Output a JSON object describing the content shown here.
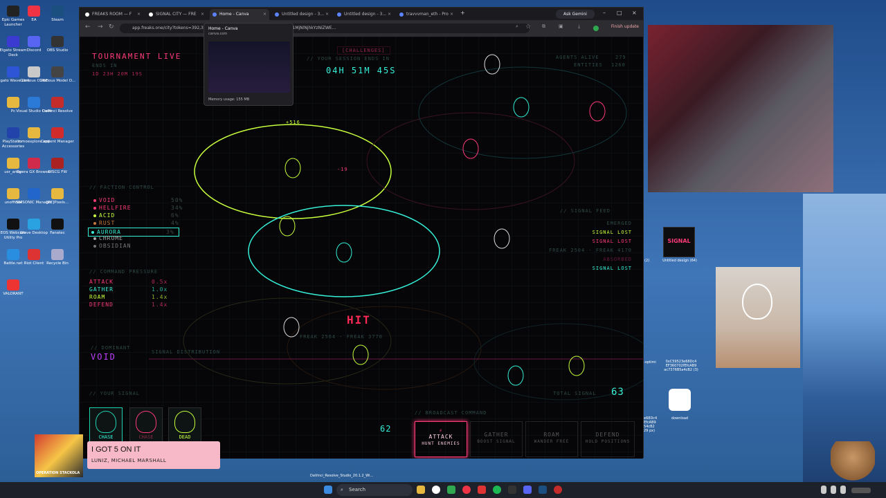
{
  "desktop_icons": [
    {
      "label": "Epic Games Launcher",
      "color": "#222"
    },
    {
      "label": "EA",
      "color": "#e34"
    },
    {
      "label": "Steam",
      "color": "#1b4f7f"
    },
    {
      "label": "Elgato Stream Deck",
      "color": "#3b3bd1"
    },
    {
      "label": "Discord",
      "color": "#5865f2"
    },
    {
      "label": "OBS Studio",
      "color": "#333"
    },
    {
      "label": "Elgato Wave Link",
      "color": "#2e55d6"
    },
    {
      "label": "Glorious CORE",
      "color": "#c9c9c9"
    },
    {
      "label": "Glorious Model O...",
      "color": "#444"
    },
    {
      "label": "Pc",
      "color": "#e7b83f"
    },
    {
      "label": "Visual Studio Code",
      "color": "#2b7ad8"
    },
    {
      "label": "DaVinci Resolve",
      "color": "#c42b2b"
    },
    {
      "label": "PlayStation Accessories",
      "color": "#2244aa"
    },
    {
      "label": "mmoexplore app",
      "color": "#e7b83f"
    },
    {
      "label": "Content Manager",
      "color": "#d12b2b"
    },
    {
      "label": "usr_army",
      "color": "#e7b83f"
    },
    {
      "label": "Opera GX Browser",
      "color": "#d12b4b"
    },
    {
      "label": "DISCG FW",
      "color": "#aa2222"
    },
    {
      "label": "unofficial",
      "color": "#e7b83f"
    },
    {
      "label": "SIMSONIC Manager",
      "color": "#2266cc"
    },
    {
      "label": "[PC]Pixels...",
      "color": "#e7b83f"
    },
    {
      "label": "EOS Webcam Utility Pro",
      "color": "#111"
    },
    {
      "label": "Glove Desktop",
      "color": "#2aa1e0"
    },
    {
      "label": "Fanatec",
      "color": "#111"
    },
    {
      "label": "Battle.net",
      "color": "#2a8ee0"
    },
    {
      "label": "Riot Client",
      "color": "#d33"
    },
    {
      "label": "Recycle Bin",
      "color": "#aac"
    },
    {
      "label": "VALORANT",
      "color": "#e33"
    }
  ],
  "browser": {
    "tabs": [
      {
        "title": "FREAKS ROOM — F"
      },
      {
        "title": "SIGNAL CITY — FRE"
      },
      {
        "title": "Home - Canva",
        "active": true
      },
      {
        "title": "Untitled design - 3..."
      },
      {
        "title": "Untitled design - 3..."
      },
      {
        "title": "travvvman_eth - Pro"
      }
    ],
    "ask_label": "Ask Gemini",
    "url": "app.freaks.one/city?tokens=392,3 ... CI6IkpXVCJ9.eyJhZGRyZXNzIjoiMHhjNTk1MjNlNjhkYzNiZWE...",
    "finish_label": "Finish update"
  },
  "tab_preview": {
    "title": "Home - Canva",
    "domain": "canva.com",
    "memory": "Memory usage: 155 MB"
  },
  "game": {
    "tournament_label": "TOURNAMENT LIVE",
    "ends_label": "ENDS IN",
    "ends_value": "1D 23H 20M 19S",
    "challenges_label": "[CHALLENGES]",
    "session_label": "// YOUR SESSION ENDS IN",
    "timer": "04H 51M 45S",
    "agents_label": "AGENTS ALIVE",
    "agents_value": "279",
    "entities_label": "ENTITIES",
    "entities_value": "1260",
    "faction_label": "// FACTION CONTROL",
    "factions": [
      {
        "name": "VOID",
        "pct": "50%",
        "color": "#ff3b78"
      },
      {
        "name": "HELLFIRE",
        "pct": "34%",
        "color": "#ff3b78"
      },
      {
        "name": "ACID",
        "pct": "6%",
        "color": "#c8ff3c"
      },
      {
        "name": "RUST",
        "pct": "4%",
        "color": "#c87a3c"
      },
      {
        "name": "AURORA",
        "pct": "3%",
        "color": "#35f1d9"
      },
      {
        "name": "CHROME",
        "pct": "",
        "color": "#aaa"
      },
      {
        "name": "OBSIDIAN",
        "pct": "",
        "color": "#777"
      }
    ],
    "command_label": "// COMMAND PRESSURE",
    "commands": [
      {
        "name": "ATTACK",
        "val": "0.5x",
        "color": "#ff3b78"
      },
      {
        "name": "GATHER",
        "val": "1.0x",
        "color": "#35f1d9"
      },
      {
        "name": "ROAM",
        "val": "1.4x",
        "color": "#c8ff3c"
      },
      {
        "name": "DEFEND",
        "val": "1.4x",
        "color": "#ff3b78"
      }
    ],
    "dominant_label": "// DOMINANT",
    "dominant_value": "VOID",
    "distribution_label": "SIGNAL DISTRIBUTION",
    "signal_feed_label": "// SIGNAL FEED",
    "feed": [
      "EMERGED",
      "SIGNAL LOST",
      "SIGNAL LOST",
      "FREAK 2504 · FREAK 4170",
      "ABSORBED",
      "SIGNAL LOST"
    ],
    "float_plus": "+516",
    "float_minus": "-19",
    "hit_label": "HIT",
    "freak_text": "FREAK 2564 · FREAK 3770",
    "your_signal_label": "// YOUR SIGNAL",
    "cards": [
      {
        "label": "CHASE",
        "color": "#35f1d9"
      },
      {
        "label": "CHASE",
        "color": "#ff3b78"
      },
      {
        "label": "DEAD",
        "color": "#c8ff3c"
      }
    ],
    "signal_value": "62",
    "total_signal_label": "TOTAL SIGNAL",
    "total_signal_value": "63",
    "broadcast_label": "// BROADCAST COMMAND",
    "buttons": [
      {
        "label": "ATTACK",
        "sub": "HUNT ENEMIES"
      },
      {
        "label": "GATHER",
        "sub": "BOOST SIGNAL"
      },
      {
        "label": "ROAM",
        "sub": "WANDER FREE"
      },
      {
        "label": "DEFEND",
        "sub": "HOLD POSITIONS"
      }
    ]
  },
  "right_desktop": {
    "file1": "Untitled design (64)",
    "file1_art": "SIGNAL",
    "file1_left": "(2)",
    "hash": "0xC59523e68Dc4 EF360702fEfcAB9 ac7376B5a4cB2 (3)",
    "download": "download",
    "optimi": "-optimi",
    "partial": "e68Dc4 EfcAB9 54cB2 29 px)"
  },
  "now_playing": {
    "title": "I GOT 5 ON IT",
    "artist": "LUNIZ, MICHAEL MARSHALL",
    "art_text": "OPERATION STACKOLA"
  },
  "taskbar": {
    "search_label": "Search",
    "pinned_label": "DaVinci_Resolve_Studio_20.1.2_Wi..."
  }
}
